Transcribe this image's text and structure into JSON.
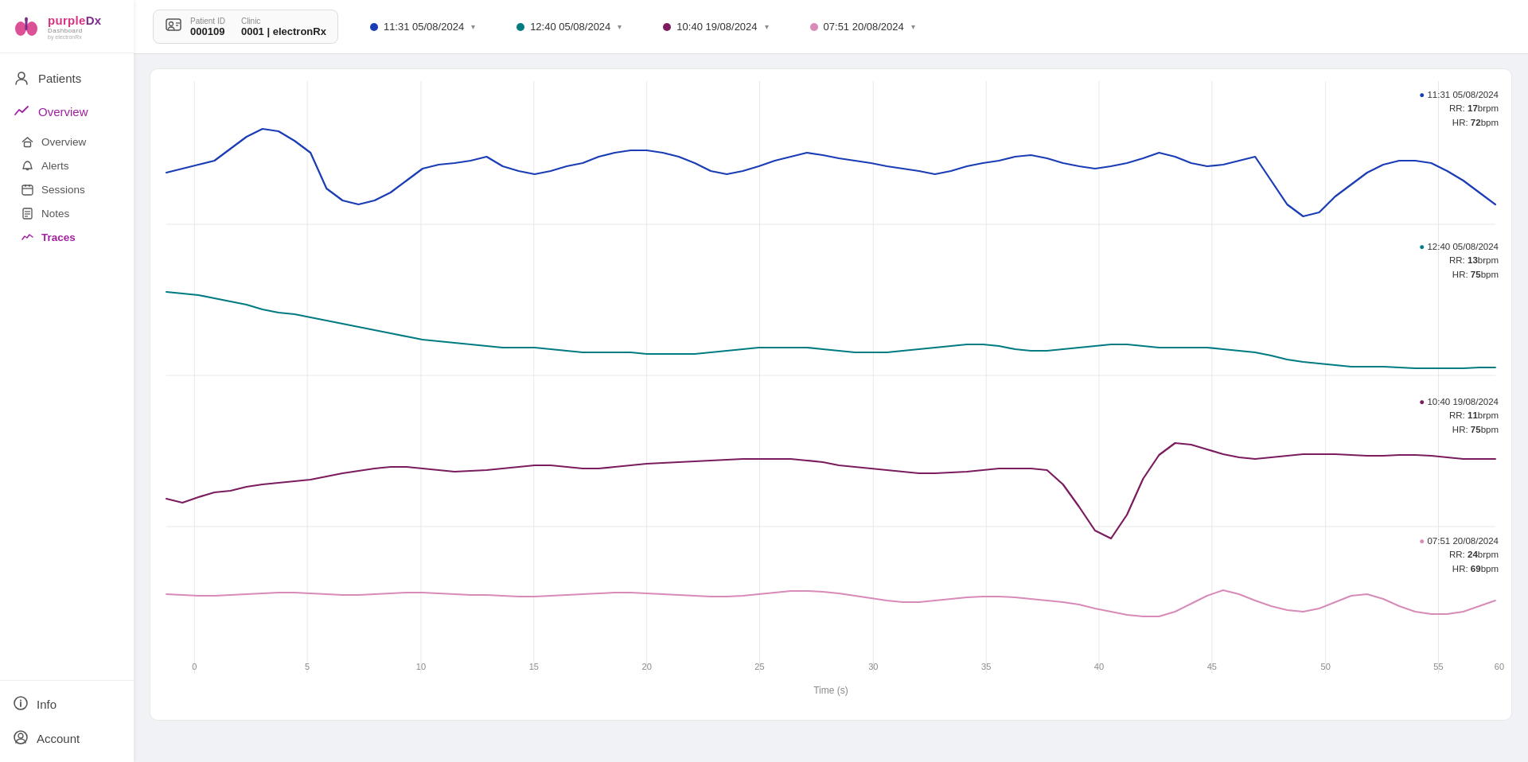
{
  "app": {
    "name": "purpleDx",
    "subtitle": "Dashboard",
    "by": "by electronRx"
  },
  "sidebar": {
    "patients_label": "Patients",
    "overview_label": "Overview",
    "sub_items": [
      {
        "label": "Overview",
        "key": "overview",
        "active": false
      },
      {
        "label": "Alerts",
        "key": "alerts",
        "active": false
      },
      {
        "label": "Sessions",
        "key": "sessions",
        "active": false
      },
      {
        "label": "Notes",
        "key": "notes",
        "active": false
      },
      {
        "label": "Traces",
        "key": "traces",
        "active": true
      }
    ],
    "info_label": "Info",
    "account_label": "Account"
  },
  "header": {
    "patient_id_label": "Patient ID",
    "patient_id": "000109",
    "clinic_label": "Clinic",
    "clinic": "0001 | electronRx",
    "sessions": [
      {
        "time": "11:31 05/08/2024",
        "color": "#1a3db5"
      },
      {
        "time": "12:40 05/08/2024",
        "color": "#007b82"
      },
      {
        "time": "10:40 19/08/2024",
        "color": "#7b1c5e"
      },
      {
        "time": "07:51 20/08/2024",
        "color": "#d88ab8"
      }
    ]
  },
  "traces": [
    {
      "label": "11:31 05/08/2024",
      "color": "#1a3db5",
      "rr": "17",
      "hr": "72",
      "rr_unit": "brpm",
      "hr_unit": "bpm"
    },
    {
      "label": "12:40 05/08/2024",
      "color": "#007b82",
      "rr": "13",
      "hr": "75",
      "rr_unit": "brpm",
      "hr_unit": "bpm"
    },
    {
      "label": "10:40 19/08/2024",
      "color": "#7b1c5e",
      "rr": "11",
      "hr": "75",
      "rr_unit": "brpm",
      "hr_unit": "bpm"
    },
    {
      "label": "07:51 20/08/2024",
      "color": "#d88ab8",
      "rr": "24",
      "hr": "69",
      "rr_unit": "brpm",
      "hr_unit": "bpm"
    }
  ],
  "x_axis": {
    "label": "Time (s)",
    "ticks": [
      0,
      5,
      10,
      15,
      20,
      25,
      30,
      35,
      40,
      45,
      50,
      55,
      60
    ]
  }
}
